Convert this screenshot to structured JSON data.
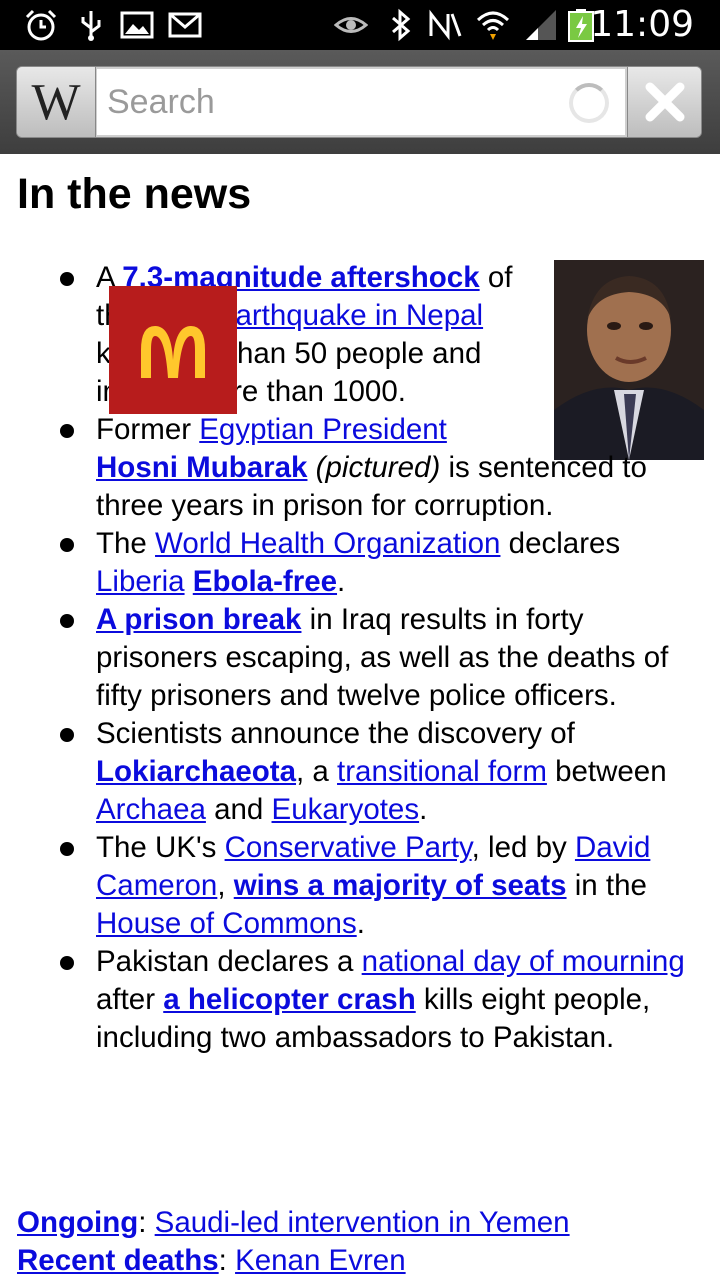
{
  "status_bar": {
    "time": "11:09",
    "left_icons": [
      "alarm-clock-icon",
      "usb-icon",
      "gallery-icon",
      "gmail-icon"
    ],
    "right_icons": [
      "eye-icon",
      "bluetooth-icon",
      "nfc-icon",
      "wifi-icon",
      "signal-icon",
      "battery-charging-icon"
    ]
  },
  "search": {
    "logo": "W",
    "placeholder": "Search"
  },
  "page": {
    "title": "In the news"
  },
  "news": [
    {
      "parts": [
        {
          "t": "A "
        },
        {
          "link": "7.3-magnitude aftershock",
          "bold": true
        },
        {
          "t": " of the 2015 "
        },
        {
          "link": "earthquake in Nepal"
        },
        {
          "t": " kills more than 50 people and injures more than 1000."
        }
      ]
    },
    {
      "parts": [
        {
          "t": "Former "
        },
        {
          "link": "Egyptian President"
        },
        {
          "t": " "
        },
        {
          "link": "Hosni Mubarak",
          "bold": true
        },
        {
          "t": " "
        },
        {
          "em": "(pictured)"
        },
        {
          "t": " is sentenced to three years in prison for corruption."
        }
      ]
    },
    {
      "parts": [
        {
          "t": "The "
        },
        {
          "link": "World Health Organization"
        },
        {
          "t": " declares "
        },
        {
          "link": "Liberia"
        },
        {
          "t": " "
        },
        {
          "link": "Ebola-free",
          "bold": true
        },
        {
          "t": "."
        }
      ]
    },
    {
      "parts": [
        {
          "link": "A prison break",
          "bold": true
        },
        {
          "t": " in Iraq results in forty prisoners escaping, as well as the deaths of fifty prisoners and twelve police officers."
        }
      ]
    },
    {
      "parts": [
        {
          "t": "Scientists announce the discovery of "
        },
        {
          "link": "Lokiarchaeota",
          "bold": true
        },
        {
          "t": ", a "
        },
        {
          "link": "transitional form"
        },
        {
          "t": " between "
        },
        {
          "link": "Archaea"
        },
        {
          "t": " and "
        },
        {
          "link": "Eukaryotes"
        },
        {
          "t": "."
        }
      ]
    },
    {
      "parts": [
        {
          "t": "The UK's "
        },
        {
          "link": "Conservative Party"
        },
        {
          "t": ", led by "
        },
        {
          "link": "David Cameron"
        },
        {
          "t": ", "
        },
        {
          "link": "wins a majority of seats",
          "bold": true
        },
        {
          "t": " in the "
        },
        {
          "link": "House of Commons"
        },
        {
          "t": "."
        }
      ]
    },
    {
      "parts": [
        {
          "t": "Pakistan declares a "
        },
        {
          "link": "national day of mourning"
        },
        {
          "t": " after "
        },
        {
          "link": "a helicopter crash",
          "bold": true
        },
        {
          "t": " kills eight people, including two ambassadors to Pakistan."
        }
      ]
    }
  ],
  "footer": {
    "ongoing_label": "Ongoing",
    "ongoing_link": "Saudi-led intervention in Yemen",
    "deaths_label": "Recent deaths",
    "deaths_link": "Kenan Evren"
  },
  "colors": {
    "link": "#0b0bdd",
    "status_bar_bg": "#000000",
    "ad_red": "#b71c1c",
    "ad_yellow": "#ffc72c"
  }
}
